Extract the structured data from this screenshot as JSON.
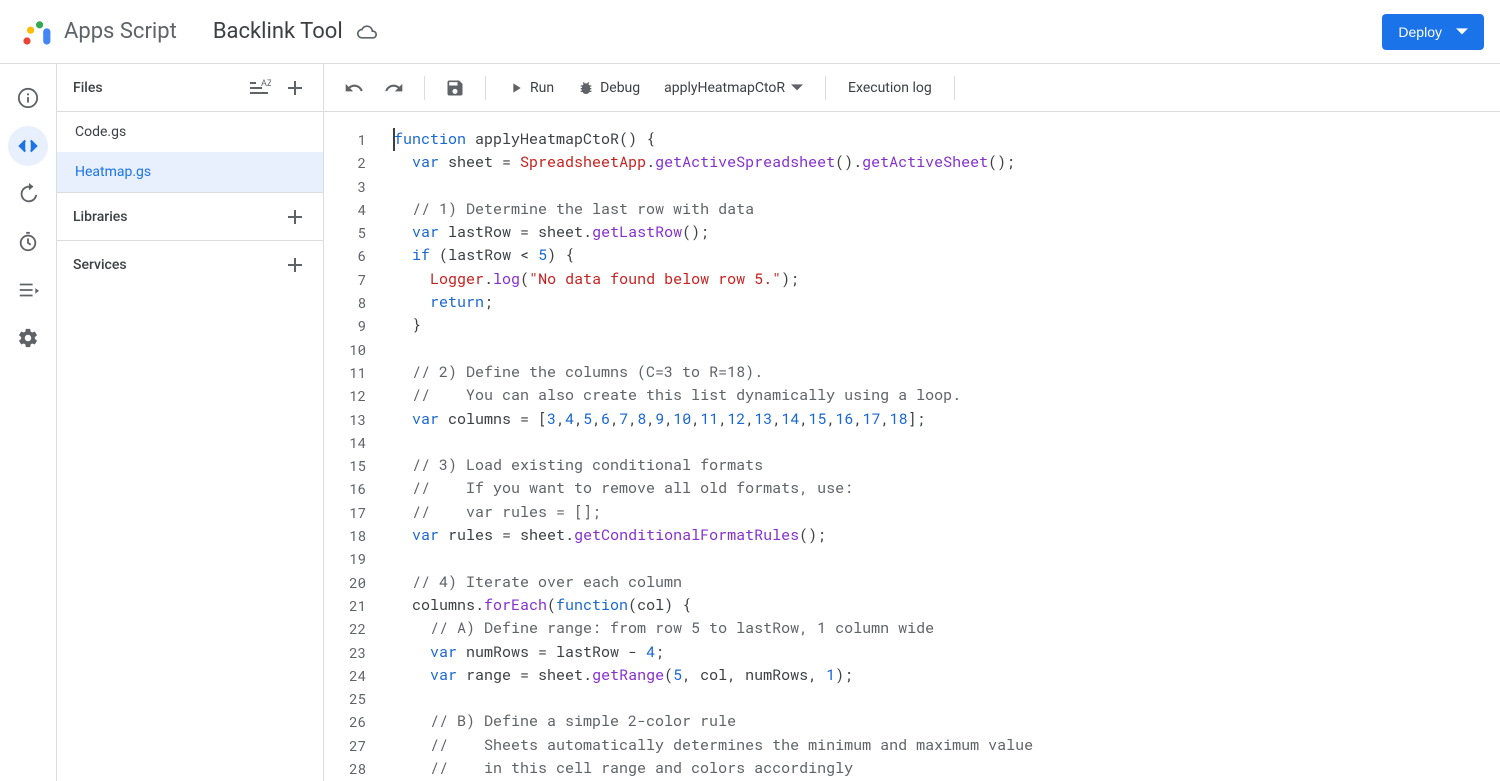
{
  "header": {
    "product": "Apps Script",
    "project": "Backlink Tool",
    "deploy": "Deploy"
  },
  "panel": {
    "files_title": "Files",
    "libraries_title": "Libraries",
    "services_title": "Services",
    "files": [
      "Code.gs",
      "Heatmap.gs"
    ],
    "active_file": "Heatmap.gs"
  },
  "toolbar": {
    "run": "Run",
    "debug": "Debug",
    "fn": "applyHeatmapCtoR",
    "log": "Execution log"
  },
  "code": {
    "lines": [
      {
        "n": 1,
        "tokens": [
          [
            "kw",
            "function"
          ],
          [
            "",
            " "
          ],
          [
            "fn",
            "applyHeatmapCtoR"
          ],
          [
            "punct",
            "()"
          ],
          [
            "",
            " "
          ],
          [
            "punct",
            "{"
          ]
        ]
      },
      {
        "n": 2,
        "tokens": [
          [
            "",
            "  "
          ],
          [
            "kw",
            "var"
          ],
          [
            "",
            " sheet = "
          ],
          [
            "type",
            "SpreadsheetApp"
          ],
          [
            "punct",
            "."
          ],
          [
            "call",
            "getActiveSpreadsheet"
          ],
          [
            "punct",
            "()."
          ],
          [
            "call",
            "getActiveSheet"
          ],
          [
            "punct",
            "();"
          ]
        ]
      },
      {
        "n": 3,
        "tokens": [
          [
            "",
            ""
          ]
        ]
      },
      {
        "n": 4,
        "tokens": [
          [
            "",
            "  "
          ],
          [
            "com",
            "// 1) Determine the last row with data"
          ]
        ]
      },
      {
        "n": 5,
        "tokens": [
          [
            "",
            "  "
          ],
          [
            "kw",
            "var"
          ],
          [
            "",
            " lastRow = sheet."
          ],
          [
            "call",
            "getLastRow"
          ],
          [
            "punct",
            "();"
          ]
        ]
      },
      {
        "n": 6,
        "tokens": [
          [
            "",
            "  "
          ],
          [
            "kw",
            "if"
          ],
          [
            "",
            " "
          ],
          [
            "punct",
            "("
          ],
          [
            "",
            "lastRow < "
          ],
          [
            "num",
            "5"
          ],
          [
            "punct",
            ") {"
          ]
        ]
      },
      {
        "n": 7,
        "tokens": [
          [
            "",
            "    "
          ],
          [
            "type",
            "Logger"
          ],
          [
            "punct",
            "."
          ],
          [
            "call",
            "log"
          ],
          [
            "punct",
            "("
          ],
          [
            "str",
            "\"No data found below row 5.\""
          ],
          [
            "punct",
            ");"
          ]
        ]
      },
      {
        "n": 8,
        "tokens": [
          [
            "",
            "    "
          ],
          [
            "kw",
            "return"
          ],
          [
            "punct",
            ";"
          ]
        ]
      },
      {
        "n": 9,
        "tokens": [
          [
            "",
            "  "
          ],
          [
            "punct",
            "}"
          ]
        ]
      },
      {
        "n": 10,
        "tokens": [
          [
            "",
            ""
          ]
        ]
      },
      {
        "n": 11,
        "tokens": [
          [
            "",
            "  "
          ],
          [
            "com",
            "// 2) Define the columns (C=3 to R=18)."
          ]
        ]
      },
      {
        "n": 12,
        "tokens": [
          [
            "",
            "  "
          ],
          [
            "com",
            "//    You can also create this list dynamically using a loop."
          ]
        ]
      },
      {
        "n": 13,
        "tokens": [
          [
            "",
            "  "
          ],
          [
            "kw",
            "var"
          ],
          [
            "",
            " columns = ["
          ],
          [
            "num",
            "3"
          ],
          [
            "punct",
            ","
          ],
          [
            "num",
            "4"
          ],
          [
            "punct",
            ","
          ],
          [
            "num",
            "5"
          ],
          [
            "punct",
            ","
          ],
          [
            "num",
            "6"
          ],
          [
            "punct",
            ","
          ],
          [
            "num",
            "7"
          ],
          [
            "punct",
            ","
          ],
          [
            "num",
            "8"
          ],
          [
            "punct",
            ","
          ],
          [
            "num",
            "9"
          ],
          [
            "punct",
            ","
          ],
          [
            "num",
            "10"
          ],
          [
            "punct",
            ","
          ],
          [
            "num",
            "11"
          ],
          [
            "punct",
            ","
          ],
          [
            "num",
            "12"
          ],
          [
            "punct",
            ","
          ],
          [
            "num",
            "13"
          ],
          [
            "punct",
            ","
          ],
          [
            "num",
            "14"
          ],
          [
            "punct",
            ","
          ],
          [
            "num",
            "15"
          ],
          [
            "punct",
            ","
          ],
          [
            "num",
            "16"
          ],
          [
            "punct",
            ","
          ],
          [
            "num",
            "17"
          ],
          [
            "punct",
            ","
          ],
          [
            "num",
            "18"
          ],
          [
            "punct",
            "];"
          ]
        ]
      },
      {
        "n": 14,
        "tokens": [
          [
            "",
            ""
          ]
        ]
      },
      {
        "n": 15,
        "tokens": [
          [
            "",
            "  "
          ],
          [
            "com",
            "// 3) Load existing conditional formats"
          ]
        ]
      },
      {
        "n": 16,
        "tokens": [
          [
            "",
            "  "
          ],
          [
            "com",
            "//    If you want to remove all old formats, use:"
          ]
        ]
      },
      {
        "n": 17,
        "tokens": [
          [
            "",
            "  "
          ],
          [
            "com",
            "//    var rules = [];"
          ]
        ]
      },
      {
        "n": 18,
        "tokens": [
          [
            "",
            "  "
          ],
          [
            "kw",
            "var"
          ],
          [
            "",
            " rules = sheet."
          ],
          [
            "call",
            "getConditionalFormatRules"
          ],
          [
            "punct",
            "();"
          ]
        ]
      },
      {
        "n": 19,
        "tokens": [
          [
            "",
            ""
          ]
        ]
      },
      {
        "n": 20,
        "tokens": [
          [
            "",
            "  "
          ],
          [
            "com",
            "// 4) Iterate over each column"
          ]
        ]
      },
      {
        "n": 21,
        "tokens": [
          [
            "",
            "  columns."
          ],
          [
            "call",
            "forEach"
          ],
          [
            "punct",
            "("
          ],
          [
            "kw",
            "function"
          ],
          [
            "punct",
            "("
          ],
          [
            "",
            "col"
          ],
          [
            "punct",
            ") {"
          ]
        ]
      },
      {
        "n": 22,
        "tokens": [
          [
            "",
            "    "
          ],
          [
            "com",
            "// A) Define range: from row 5 to lastRow, 1 column wide"
          ]
        ]
      },
      {
        "n": 23,
        "tokens": [
          [
            "",
            "    "
          ],
          [
            "kw",
            "var"
          ],
          [
            "",
            " numRows = lastRow - "
          ],
          [
            "num",
            "4"
          ],
          [
            "punct",
            ";"
          ]
        ]
      },
      {
        "n": 24,
        "tokens": [
          [
            "",
            "    "
          ],
          [
            "kw",
            "var"
          ],
          [
            "",
            " range = sheet."
          ],
          [
            "call",
            "getRange"
          ],
          [
            "punct",
            "("
          ],
          [
            "num",
            "5"
          ],
          [
            "punct",
            ", col, numRows, "
          ],
          [
            "num",
            "1"
          ],
          [
            "punct",
            ");"
          ]
        ]
      },
      {
        "n": 25,
        "tokens": [
          [
            "",
            ""
          ]
        ]
      },
      {
        "n": 26,
        "tokens": [
          [
            "",
            "    "
          ],
          [
            "com",
            "// B) Define a simple 2-color rule"
          ]
        ]
      },
      {
        "n": 27,
        "tokens": [
          [
            "",
            "    "
          ],
          [
            "com",
            "//    Sheets automatically determines the minimum and maximum value"
          ]
        ]
      },
      {
        "n": 28,
        "tokens": [
          [
            "",
            "    "
          ],
          [
            "com",
            "//    in this cell range and colors accordingly"
          ]
        ]
      }
    ]
  }
}
